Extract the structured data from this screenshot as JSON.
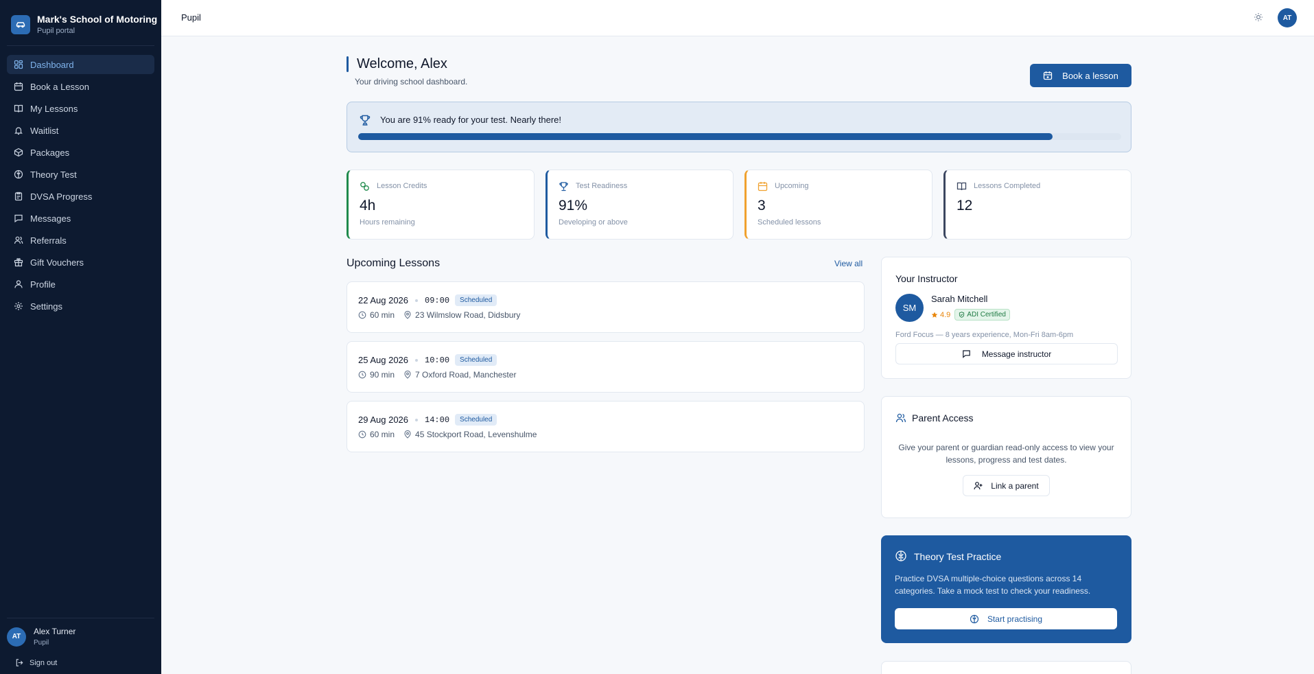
{
  "app": {
    "name": "Mark's School of Motoring",
    "subtitle": "Pupil portal"
  },
  "sidebar": {
    "items": [
      {
        "label": "Dashboard",
        "icon": "dashboard-icon",
        "active": true
      },
      {
        "label": "Book a Lesson",
        "icon": "calendar-icon"
      },
      {
        "label": "My Lessons",
        "icon": "book-icon"
      },
      {
        "label": "Waitlist",
        "icon": "bell-icon"
      },
      {
        "label": "Packages",
        "icon": "package-icon"
      },
      {
        "label": "Theory Test",
        "icon": "brain-icon"
      },
      {
        "label": "DVSA Progress",
        "icon": "clipboard-icon"
      },
      {
        "label": "Messages",
        "icon": "message-icon"
      },
      {
        "label": "Referrals",
        "icon": "users-icon"
      },
      {
        "label": "Gift Vouchers",
        "icon": "gift-icon"
      },
      {
        "label": "Profile",
        "icon": "user-icon"
      },
      {
        "label": "Settings",
        "icon": "gear-icon"
      }
    ],
    "user": {
      "initials": "AT",
      "name": "Alex Turner",
      "role": "Pupil"
    },
    "signout": "Sign out"
  },
  "topbar": {
    "title": "Pupil",
    "avatar": "AT"
  },
  "header": {
    "welcome": "Welcome, Alex",
    "subtitle": "Your driving school dashboard.",
    "book_button": "Book a lesson"
  },
  "readiness": {
    "text": "You are 91% ready for your test. Nearly there!",
    "percent": 91
  },
  "stats": [
    {
      "label": "Lesson Credits",
      "value": "4h",
      "sub": "Hours remaining",
      "color": "#1f8a4c",
      "icon": "credits-icon"
    },
    {
      "label": "Test Readiness",
      "value": "91%",
      "sub": "Developing or above",
      "color": "#1e5aa0",
      "icon": "trophy-icon"
    },
    {
      "label": "Upcoming",
      "value": "3",
      "sub": "Scheduled lessons",
      "color": "#f0a12e",
      "icon": "calendar-icon"
    },
    {
      "label": "Lessons Completed",
      "value": "12",
      "sub": "",
      "color": "#3b4660",
      "icon": "book-icon"
    }
  ],
  "upcoming": {
    "title": "Upcoming Lessons",
    "view_all": "View all",
    "lessons": [
      {
        "date": "22 Aug 2026",
        "time": "09:00",
        "status": "Scheduled",
        "duration": "60 min",
        "location": "23 Wilmslow Road, Didsbury"
      },
      {
        "date": "25 Aug 2026",
        "time": "10:00",
        "status": "Scheduled",
        "duration": "90 min",
        "location": "7 Oxford Road, Manchester"
      },
      {
        "date": "29 Aug 2026",
        "time": "14:00",
        "status": "Scheduled",
        "duration": "60 min",
        "location": "45 Stockport Road, Levenshulme"
      }
    ]
  },
  "instructor": {
    "title": "Your Instructor",
    "initials": "SM",
    "name": "Sarah Mitchell",
    "rating": "4.9",
    "badge": "ADI Certified",
    "description": "Ford Focus — 8 years experience, Mon-Fri 8am-6pm",
    "message_button": "Message instructor"
  },
  "parent": {
    "title": "Parent Access",
    "text": "Give your parent or guardian read-only access to view your lessons, progress and test dates.",
    "button": "Link a parent"
  },
  "theory": {
    "title": "Theory Test Practice",
    "text": "Practice DVSA multiple-choice questions across 14 categories. Take a mock test to check your readiness.",
    "button": "Start practising"
  }
}
